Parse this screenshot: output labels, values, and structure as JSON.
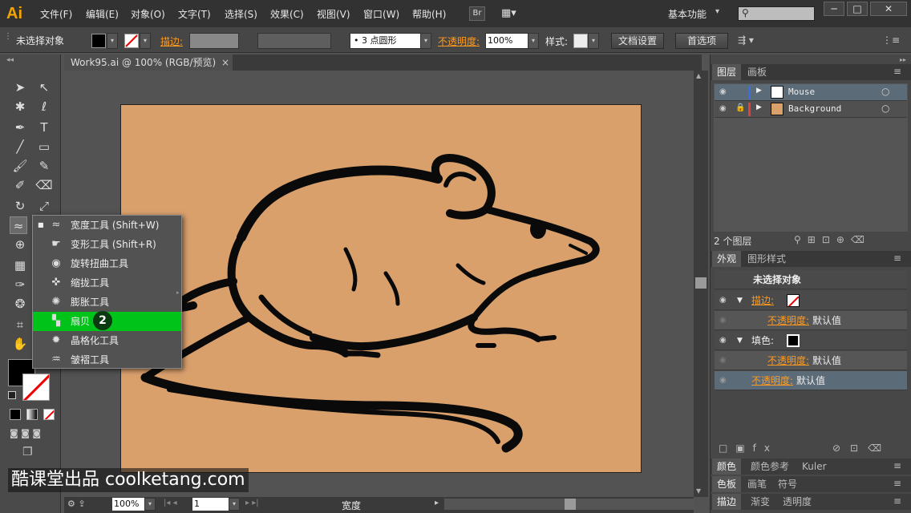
{
  "app": {
    "logo": "Ai",
    "workspace": "基本功能",
    "br": "Br"
  },
  "menus": [
    "文件(F)",
    "编辑(E)",
    "对象(O)",
    "文字(T)",
    "选择(S)",
    "效果(C)",
    "视图(V)",
    "窗口(W)",
    "帮助(H)"
  ],
  "control": {
    "no_selection": "未选择对象",
    "stroke_label": "描边:",
    "brush": "3 点圆形",
    "opacity_label": "不透明度:",
    "opacity_value": "100%",
    "style_label": "样式:",
    "doc_settings": "文档设置",
    "prefs": "首选项"
  },
  "document": {
    "tab": "Work95.ai @ 100% (RGB/预览)"
  },
  "flyout": {
    "items": [
      {
        "label": "宽度工具 (Shift+W)",
        "icon": "width-tool-icon"
      },
      {
        "label": "变形工具 (Shift+R)",
        "icon": "warp-tool-icon"
      },
      {
        "label": "旋转扭曲工具",
        "icon": "twirl-tool-icon"
      },
      {
        "label": "缩拢工具",
        "icon": "pucker-tool-icon"
      },
      {
        "label": "膨胀工具",
        "icon": "bloat-tool-icon"
      },
      {
        "label": "扇贝",
        "icon": "scallop-tool-icon"
      },
      {
        "label": "晶格化工具",
        "icon": "crystallize-tool-icon"
      },
      {
        "label": "皱褶工具",
        "icon": "wrinkle-tool-icon"
      }
    ],
    "step_badge": "2"
  },
  "layers": {
    "tabs": [
      "图层",
      "画板"
    ],
    "rows": [
      {
        "name": "Mouse",
        "color": "#3b6fe0"
      },
      {
        "name": "Background",
        "color": "#e04040"
      }
    ],
    "count": "2 个图层"
  },
  "appearance": {
    "tabs": [
      "外观",
      "图形样式"
    ],
    "header": "未选择对象",
    "stroke_label": "描边:",
    "opacity_label": "不透明度:",
    "default": "默认值",
    "fill_label": "填色:"
  },
  "bottom_panels": [
    [
      "颜色",
      "颜色参考",
      "Kuler"
    ],
    [
      "色板",
      "画笔",
      "符号"
    ],
    [
      "描边",
      "渐变",
      "透明度"
    ]
  ],
  "status": {
    "zoom": "100%",
    "page": "1",
    "tool": "宽度"
  },
  "watermark": "酷课堂出品 coolketang.com",
  "colors": {
    "artboard": "#d9a06c",
    "accent": "#00c31a",
    "orange": "#ff9a1f"
  }
}
